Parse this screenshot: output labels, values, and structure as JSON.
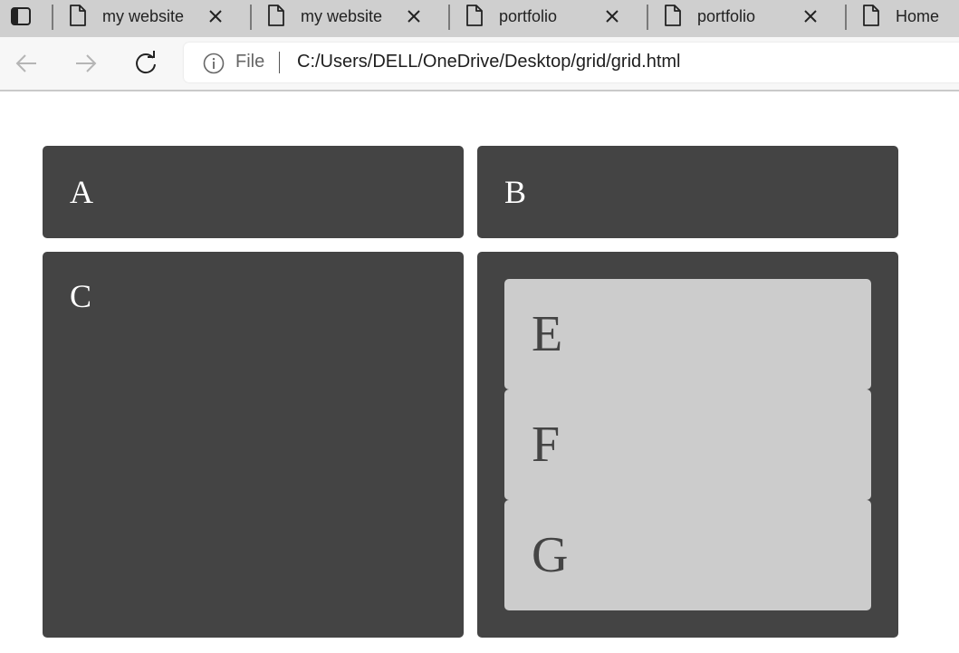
{
  "browser": {
    "tabs": [
      {
        "title": "my website"
      },
      {
        "title": "my website"
      },
      {
        "title": "portfolio"
      },
      {
        "title": "portfolio"
      },
      {
        "title": "Home"
      }
    ],
    "address": {
      "scheme_label": "File",
      "url": "C:/Users/DELL/OneDrive/Desktop/grid/grid.html"
    }
  },
  "grid": {
    "a": "A",
    "b": "B",
    "c": "C",
    "e": "E",
    "f": "F",
    "g": "G"
  },
  "colors": {
    "outer_box": "#444444",
    "inner_box": "#cccccc",
    "outer_text": "#ffffff",
    "inner_text": "#444444"
  }
}
